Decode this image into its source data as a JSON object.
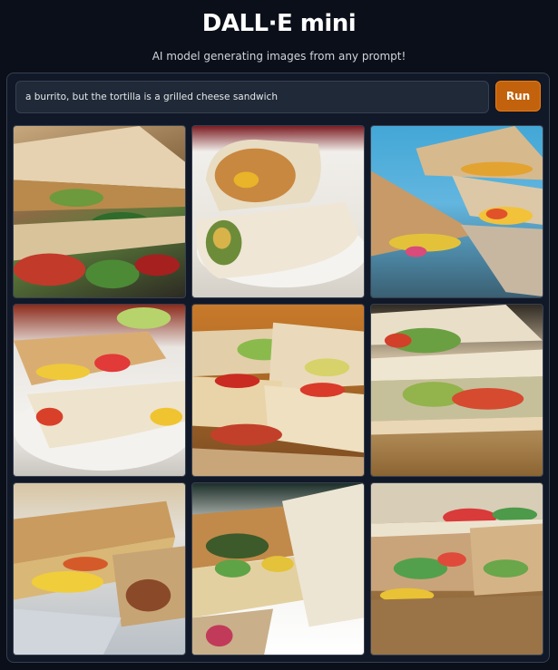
{
  "header": {
    "title": "DALL·E mini",
    "subtitle": "AI model generating images from any prompt!"
  },
  "prompt": {
    "value": "a burrito, but the tortilla is a grilled cheese sandwich",
    "run_label": "Run"
  },
  "results": [
    {
      "name": "generated-image-1"
    },
    {
      "name": "generated-image-2"
    },
    {
      "name": "generated-image-3"
    },
    {
      "name": "generated-image-4"
    },
    {
      "name": "generated-image-5"
    },
    {
      "name": "generated-image-6"
    },
    {
      "name": "generated-image-7"
    },
    {
      "name": "generated-image-8"
    },
    {
      "name": "generated-image-9"
    }
  ],
  "colors": {
    "background": "#0b0f19",
    "panel": "#111827",
    "accent": "#c2620c"
  }
}
